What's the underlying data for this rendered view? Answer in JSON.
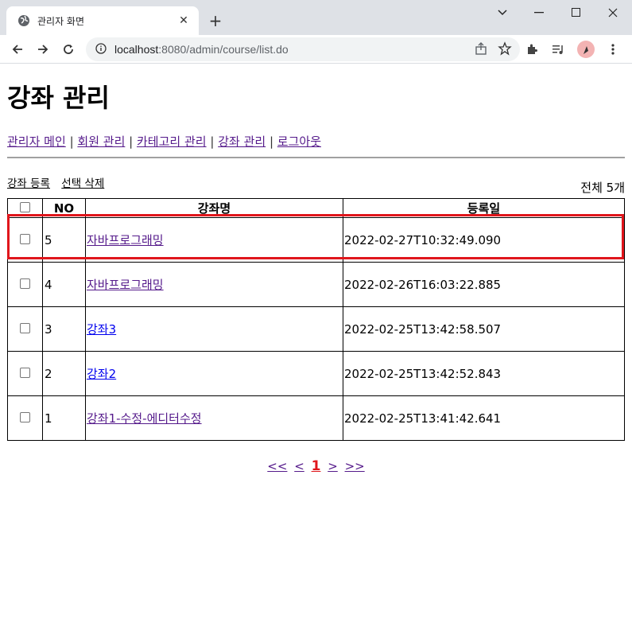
{
  "browser": {
    "tab_title": "관리자 화면",
    "new_tab": "+",
    "url_host": "localhost",
    "url_rest": ":8080/admin/course/list.do"
  },
  "page": {
    "title": "강좌 관리",
    "menu": [
      "관리자 메인",
      "회원 관리",
      "카테고리 관리",
      "강좌 관리",
      "로그아웃"
    ],
    "separator": "|",
    "actions": {
      "register": "강좌 등록",
      "delete": "선택 삭제"
    },
    "total": "전체 5개"
  },
  "table": {
    "headers": {
      "no": "NO",
      "name": "강좌명",
      "date": "등록일"
    },
    "rows": [
      {
        "no": "5",
        "name": "자바프로그래밍",
        "date": "2022-02-27T10:32:49.090",
        "visited": true
      },
      {
        "no": "4",
        "name": "자바프로그래밍",
        "date": "2022-02-26T16:03:22.885",
        "visited": true
      },
      {
        "no": "3",
        "name": "강좌3",
        "date": "2022-02-25T13:42:58.507",
        "visited": false
      },
      {
        "no": "2",
        "name": "강좌2",
        "date": "2022-02-25T13:42:52.843",
        "visited": false
      },
      {
        "no": "1",
        "name": "강좌1-수정-에디터수정",
        "date": "2022-02-25T13:41:42.641",
        "visited": true
      }
    ]
  },
  "pager": {
    "first": "<<",
    "prev": "<",
    "current": "1",
    "next": ">",
    "last": ">>"
  },
  "colors": {
    "highlight": "#e0161c",
    "visited_link": "#551a8b",
    "link": "#0000ee"
  }
}
